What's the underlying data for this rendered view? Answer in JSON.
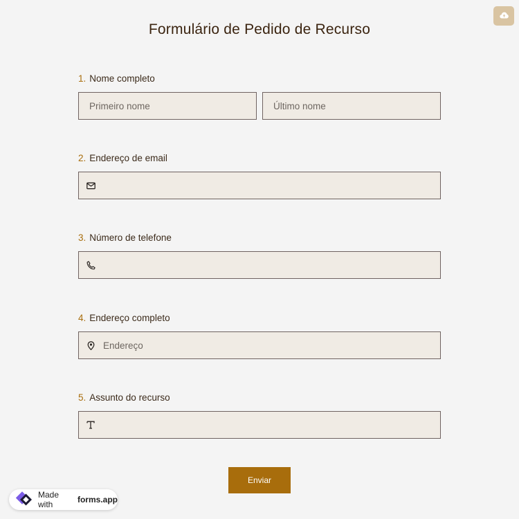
{
  "form": {
    "title": "Formulário de Pedido de Recurso",
    "accent_color": "#a86d0c",
    "field_background": "#f0ebe4",
    "questions": [
      {
        "number": "1.",
        "label": "Nome completo",
        "fields": [
          {
            "placeholder": "Primeiro nome"
          },
          {
            "placeholder": "Último nome"
          }
        ]
      },
      {
        "number": "2.",
        "label": "Endereço de email",
        "icon": "mail-icon",
        "placeholder": ""
      },
      {
        "number": "3.",
        "label": "Número de telefone",
        "icon": "phone-icon",
        "placeholder": ""
      },
      {
        "number": "4.",
        "label": "Endereço completo",
        "icon": "map-pin-icon",
        "placeholder": "Endereço"
      },
      {
        "number": "5.",
        "label": "Assunto do recurso",
        "icon": "text-icon",
        "placeholder": ""
      }
    ],
    "submit_label": "Enviar"
  },
  "toolbar": {
    "save_draft_icon": "cloud-upload-icon",
    "save_draft_color": "#d9c4a2"
  },
  "badge": {
    "prefix": "Made with",
    "brand": "forms.app"
  }
}
